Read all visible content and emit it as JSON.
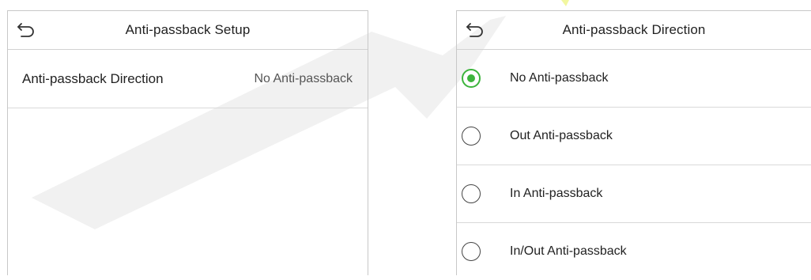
{
  "left_screen": {
    "title": "Anti-passback Setup",
    "back_icon": "back-arrow-icon",
    "settings": [
      {
        "label": "Anti-passback Direction",
        "value": "No Anti-passback"
      }
    ]
  },
  "right_screen": {
    "title": "Anti-passback Direction",
    "back_icon": "back-arrow-icon",
    "selected": "No Anti-passback",
    "options": [
      {
        "label": "No Anti-passback",
        "selected": true
      },
      {
        "label": "Out Anti-passback",
        "selected": false
      },
      {
        "label": "In Anti-passback",
        "selected": false
      },
      {
        "label": "In/Out Anti-passback",
        "selected": false
      }
    ]
  },
  "colors": {
    "accent": "#3cb43c",
    "divider": "#d9d9d9",
    "watermark": "#e8e8e8"
  }
}
